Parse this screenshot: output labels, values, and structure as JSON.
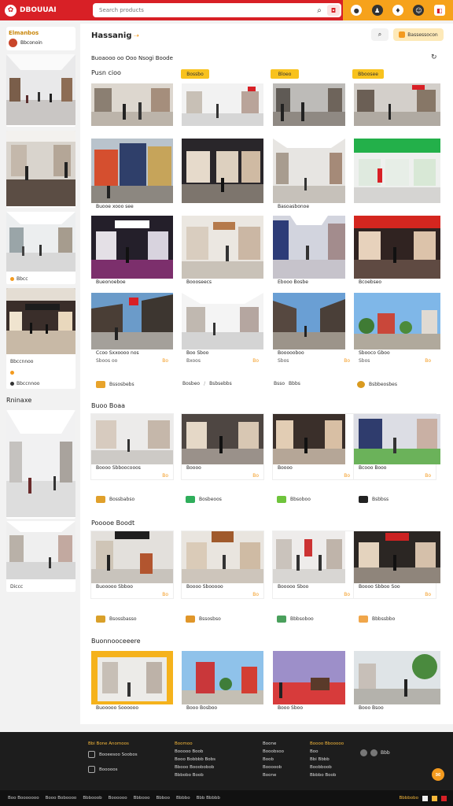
{
  "header": {
    "brand": "DBOUUAI",
    "search_placeholder": "Search products",
    "search_icon": "search-icon",
    "camera_icon": "camera-icon"
  },
  "left": {
    "title": "Elmanbos",
    "user_name": "Bbconoin",
    "cards": [
      {
        "caption": ""
      },
      {
        "caption": ""
      },
      {
        "caption": "Bbcc"
      },
      {
        "caption": "Bbccnnoo"
      }
    ],
    "section2": "Rninaxe",
    "card5_caption": "Diccc"
  },
  "main": {
    "title": "Hassanig",
    "filter_label": "Bassessocon",
    "subtitle": "Buoaooo oo Ooo Nsogi Boode",
    "sec1": "Pusn cioo",
    "tags": [
      "Bossbo",
      "Bloeo",
      "Bboosee"
    ],
    "grid_captions_row2": [
      "Buooe xooo see",
      "",
      "Basoasbonoe",
      ""
    ],
    "grid_captions_row3": [
      "Bueonoeboe",
      "Boooseecs",
      "Ebooo Bosbe",
      "Bcoebseo"
    ],
    "row4_captions": [
      {
        "t1": "Ccoo Sxxoooo nos",
        "t2": "Sboos oo",
        "price": "Bo"
      },
      {
        "t1": "Boo Sboo",
        "t2": "Bxoos",
        "price": "Bo"
      },
      {
        "t1": "Boooooboo",
        "t2": "Sbos",
        "price": "Bo"
      },
      {
        "t1": "Sbooco Gboo",
        "t2": "Sbos",
        "price": "Bo"
      }
    ],
    "row4_foot": [
      "Bssosbebs",
      "Bosbeo",
      "Bsbsebbs",
      "Bsso",
      "Bbbs",
      "Bsbbeosbes",
      "Bbcc"
    ],
    "sec2": "Buoo Boaa",
    "row5_captions": [
      {
        "t1": "Boooo Sbboocooos",
        "price": "Bo"
      },
      {
        "t1": "Boooo",
        "price": "Bo"
      },
      {
        "t1": "Boooo",
        "price": "Bo"
      },
      {
        "t1": "Bcooo Booo",
        "price": "Bo"
      }
    ],
    "row5_foot": [
      "Bossbabso",
      "Bosbeoos",
      "Bbsoboo",
      "Bsbbss"
    ],
    "sec3": "Pooooe Boodt",
    "row6_captions": [
      {
        "t1": "Buooooo Sbboo",
        "price": "Bo"
      },
      {
        "t1": "Boooo Sbooooo",
        "price": "Bo"
      },
      {
        "t1": "Booooo Sboo",
        "price": "Bo"
      },
      {
        "t1": "Boooo Sbboo Soo",
        "price": "Bo"
      }
    ],
    "row6_foot": [
      "Bsossbasso",
      "Bssosbso",
      "Bbbsoboo",
      "Bbbssbbo"
    ],
    "sec4": "Buonnooceeere",
    "row7_captions": [
      "Buooooo Soooooo",
      "Booo Bosboo",
      "Booo Sboo",
      "Booo Bsoo"
    ]
  },
  "footer": {
    "col1_h": "Bbi Bone Anomoos",
    "col1_items": [
      "Booeesoo Soobos",
      "Booooos"
    ],
    "col2_h": "Boomoo",
    "col2_items": [
      "Booooo Boob",
      "Booo Bobbbb Bobs",
      "Bbooo Booobobob",
      "Bbbobo Boob"
    ],
    "col3_h": "Boone",
    "col3_items": [
      "Booobsoo",
      "Boob",
      "Booooob",
      "Boone"
    ],
    "col4_h": "Boooo Bbooooo",
    "col4_items": [
      "Boo",
      "Bbi Bbbb",
      "Boobboob",
      "Bbbbo Boob"
    ],
    "social": "Bbb"
  },
  "bottom": {
    "items": [
      "Boo Booooooo",
      "Booo Boboooo",
      "Bbbooob",
      "Boooooo",
      "Bbbooo",
      "Bbboo",
      "Bbbbo",
      "Bbb Bbbbb"
    ],
    "right": "Bbbbobo"
  }
}
